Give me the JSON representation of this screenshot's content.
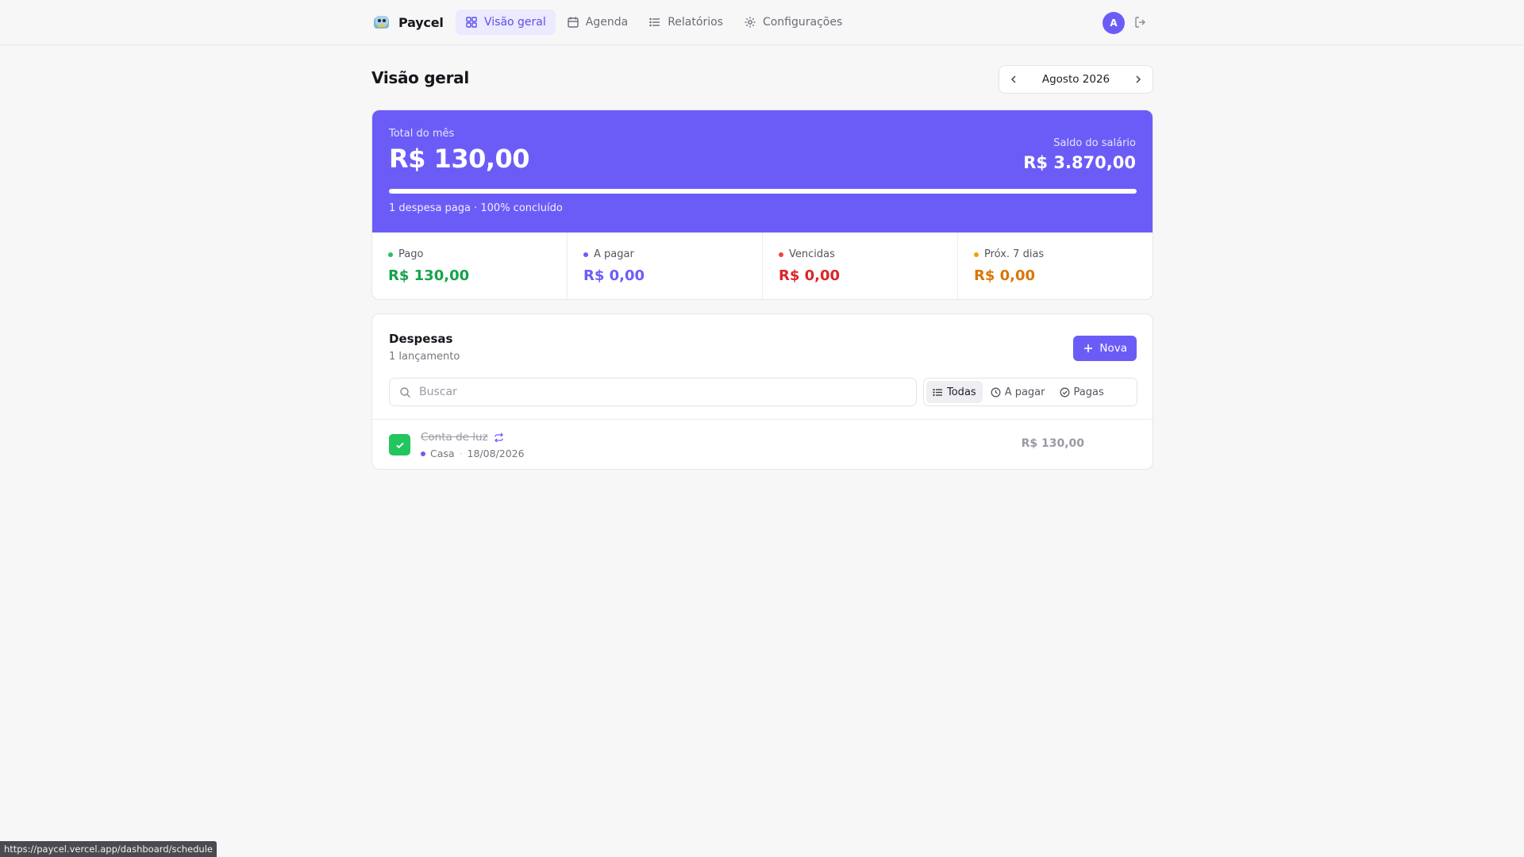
{
  "app": {
    "name": "Paycel"
  },
  "nav": {
    "items": [
      {
        "label": "Visão geral",
        "icon": "grid-icon",
        "active": true
      },
      {
        "label": "Agenda",
        "icon": "calendar-icon",
        "active": false
      },
      {
        "label": "Relatórios",
        "icon": "list-icon",
        "active": false
      },
      {
        "label": "Configurações",
        "icon": "gear-icon",
        "active": false
      }
    ]
  },
  "user": {
    "avatar_initial": "A"
  },
  "page": {
    "title": "Visão geral"
  },
  "month_picker": {
    "label": "Agosto 2026"
  },
  "summary": {
    "total_label": "Total do mês",
    "total_value": "R$ 130,00",
    "salary_label": "Saldo do salário",
    "salary_value": "R$ 3.870,00",
    "progress": 1.0,
    "caption": "1 despesa paga · 100% concluído",
    "stats": [
      {
        "label": "Pago",
        "value": "R$ 130,00",
        "color": "#16a34a",
        "dot": "#22c55e"
      },
      {
        "label": "A pagar",
        "value": "R$ 0,00",
        "color": "#6c5cf7",
        "dot": "#6c5cf7"
      },
      {
        "label": "Vencidas",
        "value": "R$ 0,00",
        "color": "#dc2626",
        "dot": "#ef4444"
      },
      {
        "label": "Próx. 7 dias",
        "value": "R$ 0,00",
        "color": "#d97706",
        "dot": "#f59e0b"
      }
    ]
  },
  "expenses": {
    "title": "Despesas",
    "subtitle": "1 lançamento",
    "new_button": "Nova",
    "search_placeholder": "Buscar",
    "filters": [
      {
        "label": "Todas",
        "icon": "list-icon",
        "active": true
      },
      {
        "label": "A pagar",
        "icon": "clock-icon",
        "active": false
      },
      {
        "label": "Pagas",
        "icon": "check-circle-icon",
        "active": false
      }
    ],
    "rows": [
      {
        "name": "Conta de luz",
        "category": "Casa",
        "category_color": "#6c5cf7",
        "date": "18/08/2026",
        "amount": "R$ 130,00",
        "paid": true,
        "recurring": true
      }
    ]
  },
  "status_bar": {
    "url": "https://paycel.vercel.app/dashboard/schedule"
  },
  "colors": {
    "accent": "#6c5cf7",
    "paid": "#22c55e"
  }
}
